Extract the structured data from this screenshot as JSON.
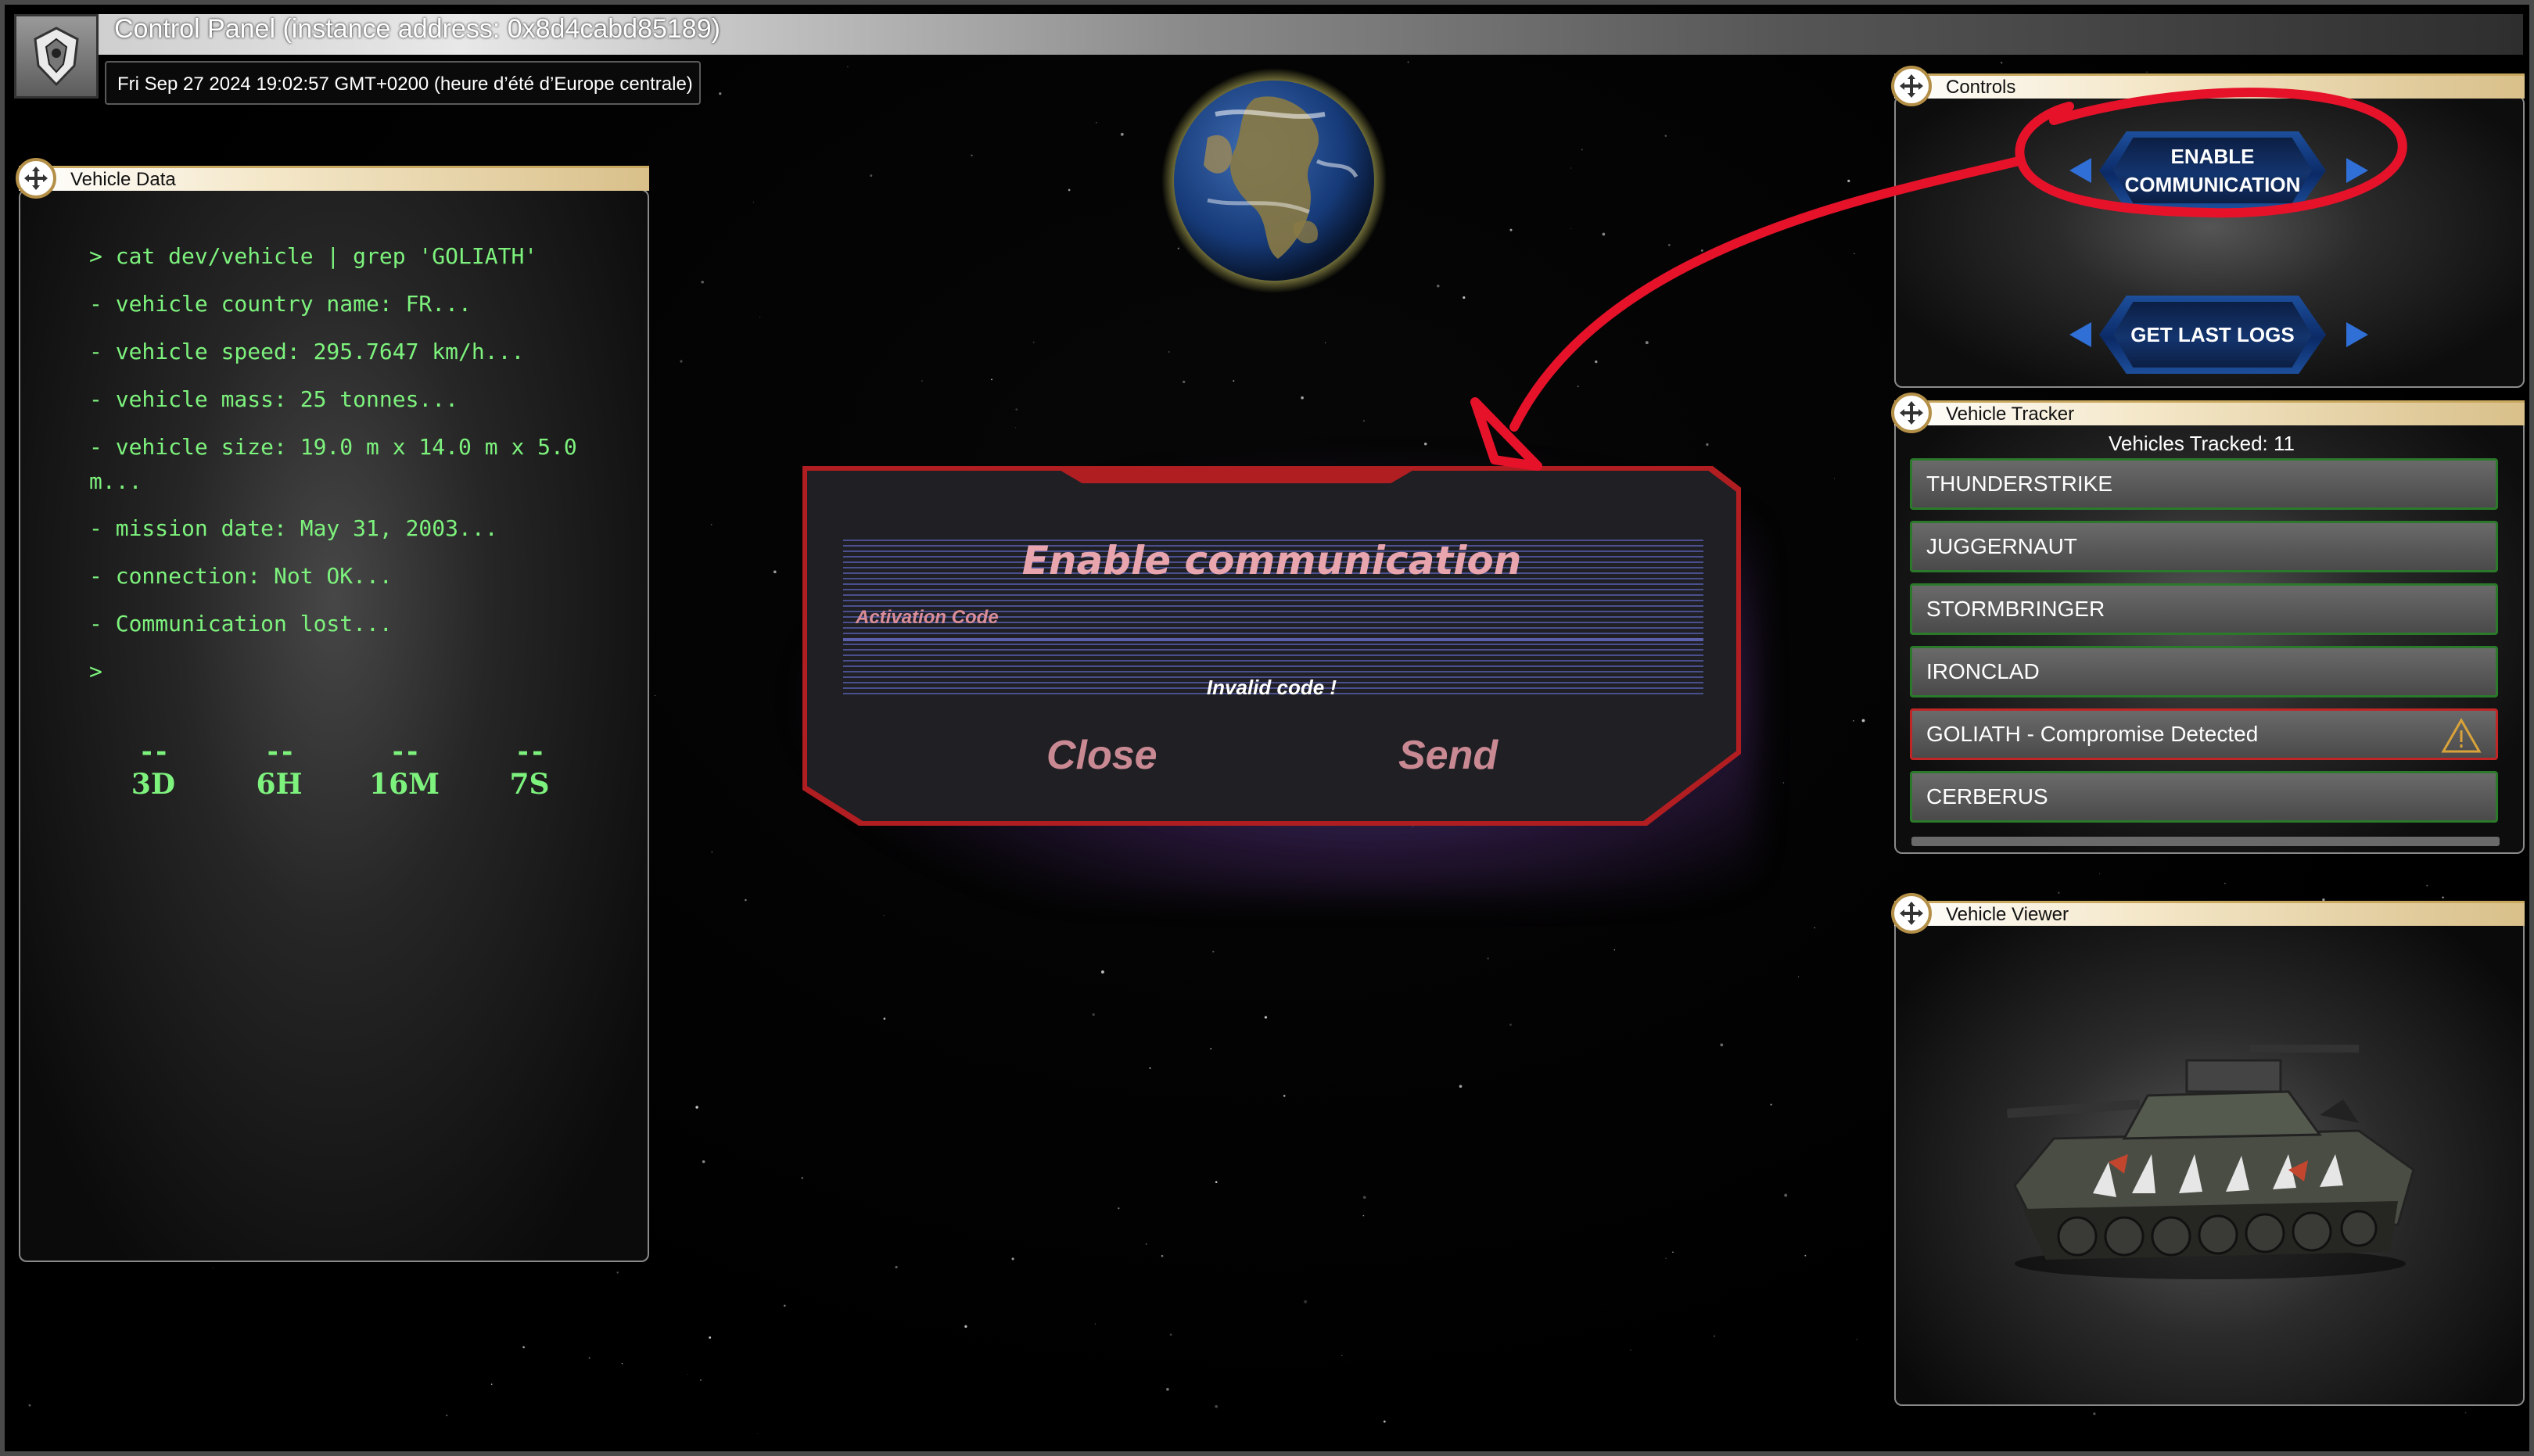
{
  "window": {
    "title": "Control Panel (instance address: 0x8d4cabd85189)",
    "datetime": "Fri Sep 27 2024 19:02:57 GMT+0200 (heure d’été d’Europe centrale)"
  },
  "vehicle_data": {
    "header": "Vehicle Data",
    "terminal_lines": [
      "> cat dev/vehicle | grep 'GOLIATH'",
      "- vehicle country name: FR...",
      "- vehicle speed: 295.7647 km/h...",
      "- vehicle mass: 25 tonnes...",
      "- vehicle size: 19.0 m x 14.0 m x 5.0",
      "m...",
      "- mission date: May 31, 2003...",
      "- connection: Not OK...",
      "- Communication lost...",
      ">"
    ],
    "timers": [
      {
        "value": "--",
        "unit": "3D"
      },
      {
        "value": "--",
        "unit": "6H"
      },
      {
        "value": "--",
        "unit": "16M"
      },
      {
        "value": "--",
        "unit": "7S"
      }
    ]
  },
  "controls": {
    "header": "Controls",
    "enable_line1": "ENABLE",
    "enable_line2": "COMMUNICATION",
    "logs_label": "GET LAST LOGS"
  },
  "tracker": {
    "header": "Vehicle Tracker",
    "count_text": "Vehicles Tracked: 11",
    "items": [
      {
        "name": "THUNDERSTRIKE"
      },
      {
        "name": "JUGGERNAUT"
      },
      {
        "name": "STORMBRINGER"
      },
      {
        "name": "IRONCLAD"
      },
      {
        "name": "GOLIATH - Compromise Detected"
      },
      {
        "name": "CERBERUS"
      }
    ]
  },
  "viewer": {
    "header": "Vehicle Viewer"
  },
  "modal": {
    "title": "Enable communication",
    "field_label": "Activation Code",
    "input_value": "",
    "error": "Invalid code !",
    "close_label": "Close",
    "send_label": "Send"
  },
  "colors": {
    "terminal_green": "#7df27d",
    "alert_red": "#c02626",
    "ok_green": "#2b7a2b",
    "accent_gold": "#b48f48",
    "button_blue": "#2f6fd6",
    "modal_red": "#b01e22",
    "annotation_red": "#e5122a"
  }
}
